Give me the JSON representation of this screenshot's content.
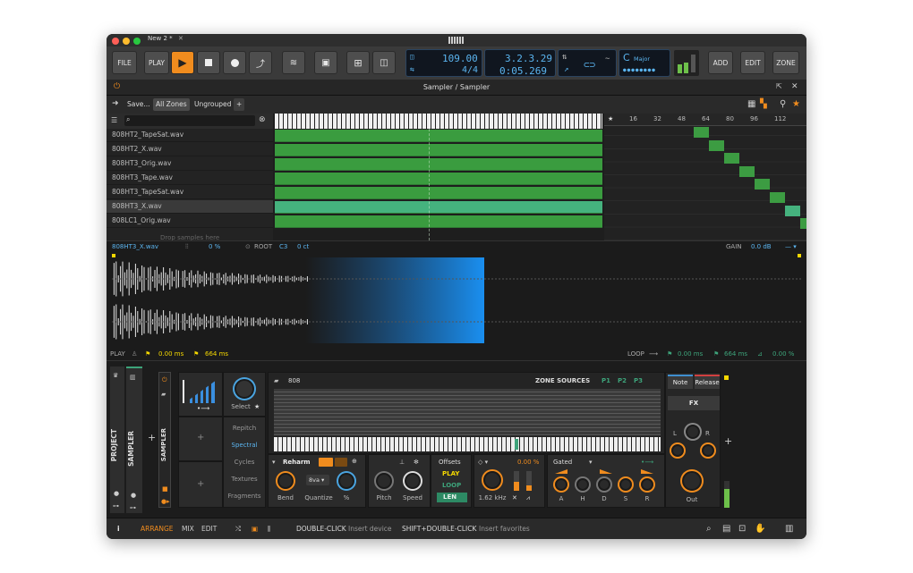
{
  "window": {
    "tab_title": "New 2 *",
    "close_glyph": "✕"
  },
  "toolbar": {
    "file": "FILE",
    "play_label": "PLAY",
    "tempo": "109.00",
    "time_sig": "4/4",
    "position": "3.2.3.29",
    "time": "0:05.269",
    "key": "C",
    "key_mode": "Major",
    "add": "ADD",
    "edit": "EDIT",
    "zone": "ZONE"
  },
  "pane": {
    "title": "Sampler / Sampler"
  },
  "zones": {
    "save": "Save...",
    "all_zones": "All Zones",
    "ungrouped": "Ungrouped",
    "plus": "+",
    "search_glyph": "🔍"
  },
  "velocity_ruler": [
    "16",
    "32",
    "48",
    "64",
    "80",
    "96",
    "112"
  ],
  "files": [
    "808HT2_TapeSat.wav",
    "808HT2_X.wav",
    "808HT3_Orig.wav",
    "808HT3_Tape.wav",
    "808HT3_TapeSat.wav",
    "808HT3_X.wav",
    "808LC1_Orig.wav"
  ],
  "drop_hint": "Drop samples here",
  "wave": {
    "sample_name": "808HT3_X.wav",
    "pitch_pct": "0 %",
    "root_label": "ROOT",
    "root_value": "C3",
    "cents": "0 ct",
    "gain_label": "GAIN",
    "gain_value": "0.0 dB",
    "play_label": "PLAY",
    "play_start": "0.00 ms",
    "play_end": "664 ms",
    "loop_label": "LOOP",
    "loop_start": "0.00 ms",
    "loop_end": "664 ms",
    "loop_xfade": "0.00 %"
  },
  "device": {
    "project_label": "PROJECT",
    "sampler_tab": "SAMPLER",
    "sampler_label": "SAMPLER",
    "select_label": "Select",
    "modes": [
      "Repitch",
      "Spectral",
      "Cycles",
      "Textures",
      "Fragments"
    ],
    "preset_name": "808",
    "zone_sources": "ZONE SOURCES",
    "sources": [
      "P1",
      "P2",
      "P3"
    ],
    "reharm": "Reharm",
    "bend": "Bend",
    "quantize": "Quantize",
    "quantize_value": "8va",
    "percent": "%",
    "pitch": "Pitch",
    "speed": "Speed",
    "offsets": "Offsets",
    "offsets_play": "PLAY",
    "offsets_loop": "LOOP",
    "offsets_len": "LEN",
    "filter_freq": "1.62 kHz",
    "filter_pct": "0.00 %",
    "env_mode": "Gated",
    "env_knobs": [
      "A",
      "H",
      "D",
      "S",
      "R"
    ],
    "note_btn": "Note",
    "release_btn": "Release",
    "fx_btn": "FX",
    "lr_l": "L",
    "lr_r": "R",
    "out": "Out"
  },
  "status": {
    "info": "i",
    "arrange": "ARRANGE",
    "mix": "MIX",
    "edit": "EDIT",
    "dbl_click": "DOUBLE-CLICK",
    "dbl_click_action": "Insert device",
    "shift_dbl": "SHIFT+DOUBLE-CLICK",
    "shift_dbl_action": "Insert favorites"
  },
  "colors": {
    "accent": "#f08c1e",
    "blue": "#4aa4e0",
    "green": "#3a9c3f"
  }
}
